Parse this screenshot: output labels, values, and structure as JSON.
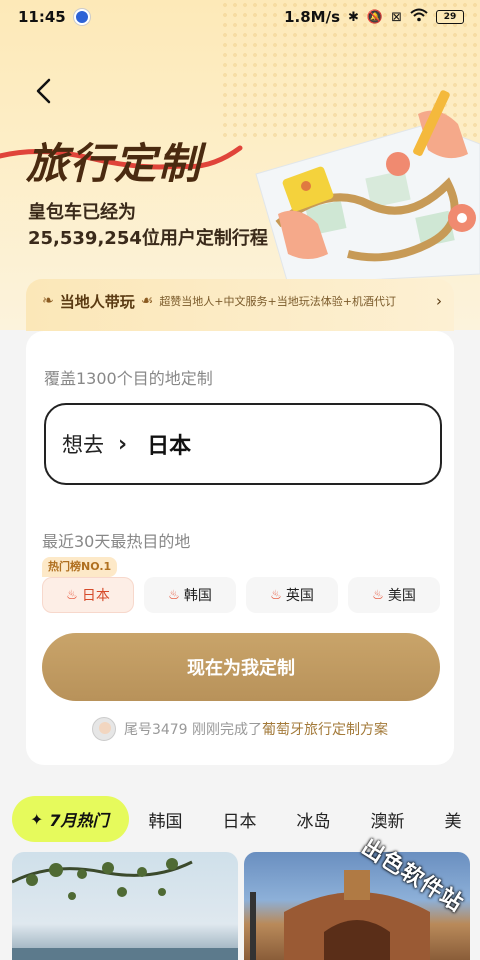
{
  "status_bar": {
    "time": "11:45",
    "speed": "1.8M/s",
    "battery": "29",
    "icons": [
      "app-icon",
      "bluetooth-icon",
      "mute-icon",
      "sim-icon",
      "wifi-icon",
      "battery-icon"
    ]
  },
  "hero": {
    "title": "旅行定制",
    "subtitle_line1": "皇包车已经为",
    "subtitle_line2": "25,539,254位用户定制行程"
  },
  "guide": {
    "title": "当地人带玩",
    "description": "超赞当地人+中文服务+当地玩法体验+机酒代订"
  },
  "form": {
    "coverage_label": "覆盖1300个目的地定制",
    "want_label": "想去",
    "destination": "日本",
    "hot_label": "最近30天最热目的地",
    "rank_badge": "热门榜NO.1",
    "hot_destinations": [
      "日本",
      "韩国",
      "英国",
      "美国"
    ],
    "cta_label": "现在为我定制",
    "notice_prefix": "尾号3479 刚刚完成了",
    "notice_link": "葡萄牙旅行定制方案"
  },
  "tabs": {
    "hot_tab": "7月热门",
    "items": [
      "韩国",
      "日本",
      "冰岛",
      "澳新",
      "美"
    ]
  },
  "watermark": "出色软件站",
  "colors": {
    "accent_gold": "#b8925a",
    "hot_tab_bg": "#e6fa5c",
    "flame": "#e5482b"
  }
}
